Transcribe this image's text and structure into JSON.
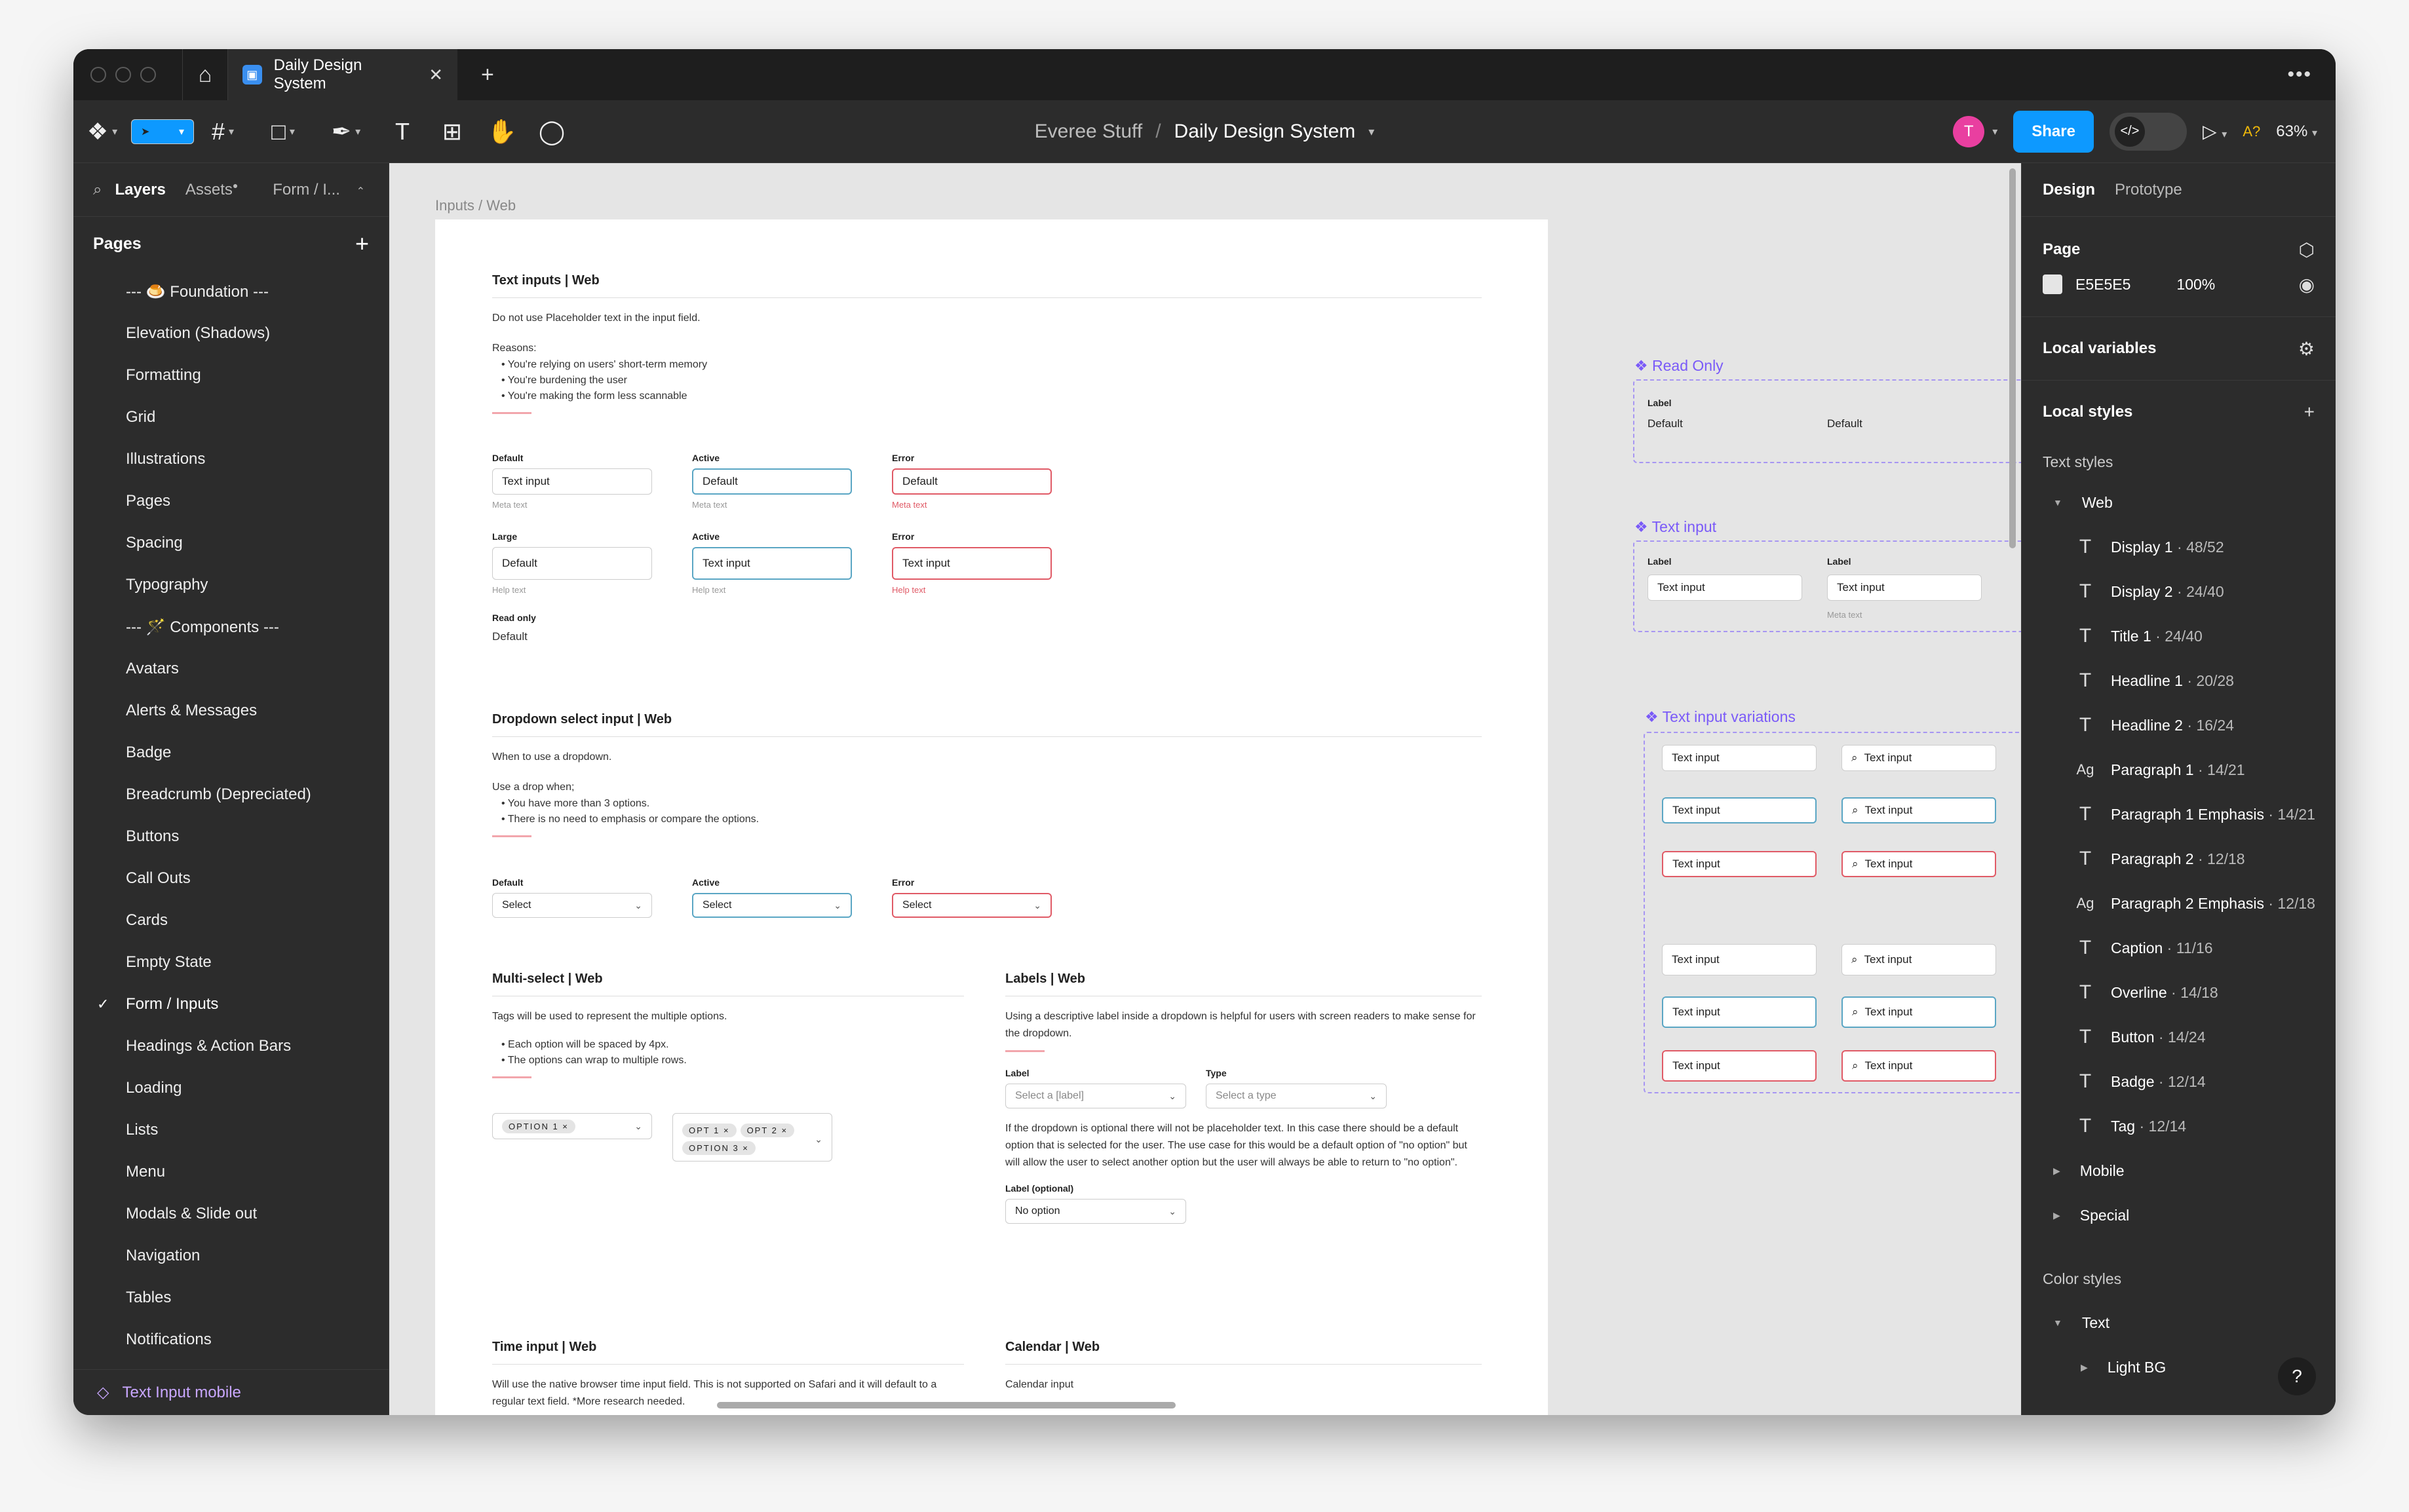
{
  "tab": {
    "title": "Daily Design System",
    "close": "✕",
    "new": "+"
  },
  "toolbar": {
    "project": "Everee Stuff",
    "sep": "/",
    "file": "Daily Design System",
    "avatar": "T",
    "share": "Share",
    "a11y": "A?",
    "zoom": "63%"
  },
  "left": {
    "tabs": [
      "Layers",
      "Assets",
      "Form / I..."
    ],
    "pages_title": "Pages",
    "pages": [
      "--- 🍮 Foundation ---",
      "Elevation (Shadows)",
      "Formatting",
      "Grid",
      "Illustrations",
      "Pages",
      "Spacing",
      "Typography",
      "--- 🪄 Components ---",
      "Avatars",
      "Alerts & Messages",
      "Badge",
      "Breadcrumb (Depreciated)",
      "Buttons",
      "Call Outs",
      "Cards",
      "Empty State",
      "Form / Inputs",
      "Headings & Action Bars",
      "Loading",
      "Lists",
      "Menu",
      "Modals & Slide out",
      "Navigation",
      "Tables",
      "Notifications"
    ],
    "current_index": 17,
    "bottom": "Text Input mobile"
  },
  "canvas": {
    "frame_title": "Inputs / Web",
    "text_inputs": {
      "title": "Text inputs | Web",
      "intro": "Do not use Placeholder text in the input field.",
      "reasons_label": "Reasons:",
      "reasons": [
        "You're relying on users' short-term memory",
        "You're burdening the user",
        "You're making the form less scannable"
      ],
      "default_label": "Default",
      "default_value": "Text input",
      "default_meta": "Meta text",
      "active_label": "Active",
      "active_value": "Default",
      "active_meta": "Meta text",
      "error_label": "Error",
      "error_value": "Default",
      "error_meta": "Meta text",
      "large_label": "Large",
      "large_value": "Default",
      "large_help": "Help text",
      "lactive_label": "Active",
      "lactive_value": "Text input",
      "lactive_help": "Help text",
      "lerror_label": "Error",
      "lerror_value": "Text input",
      "lerror_help": "Help text",
      "readonly_label": "Read only",
      "readonly_value": "Default"
    },
    "dropdown": {
      "title": "Dropdown select input | Web",
      "intro": "When to use a dropdown.",
      "use_label": "Use a drop when;",
      "bullets": [
        "You have more than 3 options.",
        "There is no need to emphasis or compare the options."
      ],
      "default_label": "Default",
      "active_label": "Active",
      "error_label": "Error",
      "value": "Select"
    },
    "multi": {
      "title": "Multi-select | Web",
      "intro": "Tags will be used to represent the multiple options.",
      "bullets": [
        "Each option will be spaced by 4px.",
        "The options can wrap to multiple rows."
      ],
      "tag1": "OPTION 1",
      "tag2": "OPT 1",
      "tag3": "OPT 2",
      "tag4": "OPTION 3"
    },
    "labels": {
      "title": "Labels | Web",
      "intro": "Using a descriptive label inside a dropdown is helpful for users with screen readers to make sense for the dropdown.",
      "label1": "Label",
      "value1": "Select a [label]",
      "label2": "Type",
      "value2": "Select a type",
      "para": "If the dropdown is optional there will not be placeholder text. In this case there should be a default option that is selected for the user. The use case for this would be a default option of \"no option\" but will allow the user to select another option but the user will always be able to return to \"no option\".",
      "optional_label": "Label (optional)",
      "optional_value": "No option"
    },
    "time": {
      "title": "Time input | Web",
      "intro": "Will use the native browser time input field. This is not supported on Safari and it will default to a regular text field. *More research needed."
    },
    "calendar": {
      "title": "Calendar | Web",
      "intro": "Calendar input"
    },
    "comp_readonly": {
      "title": "❖ Read Only",
      "label": "Label",
      "value1": "Default",
      "value2": "Default"
    },
    "comp_textinput": {
      "title": "❖ Text input",
      "label1": "Label",
      "label2": "Label",
      "value": "Text input",
      "meta": "Meta text"
    },
    "comp_variations": {
      "title": "❖ Text input variations",
      "value": "Text input"
    }
  },
  "right": {
    "tabs": [
      "Design",
      "Prototype"
    ],
    "page_title": "Page",
    "page_color": "E5E5E5",
    "page_opacity": "100%",
    "local_variables": "Local variables",
    "local_styles": "Local styles",
    "text_styles": "Text styles",
    "web_group": "Web",
    "styles": [
      {
        "icon": "T",
        "name": "Display 1",
        "meta": "48/52"
      },
      {
        "icon": "T",
        "name": "Display 2",
        "meta": "24/40"
      },
      {
        "icon": "T",
        "name": "Title 1",
        "meta": "24/40"
      },
      {
        "icon": "T",
        "name": "Headline 1",
        "meta": "20/28"
      },
      {
        "icon": "T",
        "name": "Headline 2",
        "meta": "16/24"
      },
      {
        "icon": "Ag",
        "name": "Paragraph 1",
        "meta": "14/21"
      },
      {
        "icon": "T",
        "name": "Paragraph 1 Emphasis",
        "meta": "14/21"
      },
      {
        "icon": "T",
        "name": "Paragraph 2",
        "meta": "12/18"
      },
      {
        "icon": "Ag",
        "name": "Paragraph 2 Emphasis",
        "meta": "12/18"
      },
      {
        "icon": "T",
        "name": "Caption",
        "meta": "11/16"
      },
      {
        "icon": "T",
        "name": "Overline",
        "meta": "14/18"
      },
      {
        "icon": "T",
        "name": "Button",
        "meta": "14/24"
      },
      {
        "icon": "T",
        "name": "Badge",
        "meta": "12/14"
      },
      {
        "icon": "T",
        "name": "Tag",
        "meta": "12/14"
      }
    ],
    "mobile_group": "Mobile",
    "special_group": "Special",
    "color_styles": "Color styles",
    "text_group": "Text",
    "lightbg_group": "Light BG",
    "help": "?"
  }
}
